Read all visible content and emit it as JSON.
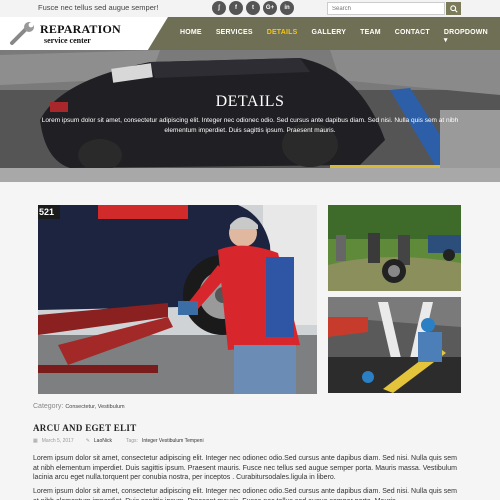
{
  "topbar": {
    "tagline": "Fusce nec tellus sed augue semper!",
    "socials": [
      {
        "icon": "rss-icon",
        "glyph": "ʃ"
      },
      {
        "icon": "facebook-icon",
        "glyph": "f"
      },
      {
        "icon": "twitter-icon",
        "glyph": "t"
      },
      {
        "icon": "google-plus-icon",
        "glyph": "G+"
      },
      {
        "icon": "linkedin-icon",
        "glyph": "in"
      }
    ],
    "search_placeholder": "Search"
  },
  "logo": {
    "title": "REPARATION",
    "subtitle": "service center"
  },
  "nav": {
    "items": [
      "HOME",
      "SERVICES",
      "DETAILS",
      "GALLERY",
      "TEAM",
      "CONTACT",
      "DROPDOWN ▾"
    ],
    "active_index": 2
  },
  "hero": {
    "title": "DETAILS",
    "text": "Lorem ipsum dolor sit amet, consectetur adipiscing elit. Integer nec odionec odio. Sed cursus ante dapibus diam. Sed nisi. Nulla quis sem at nibh elementum imperdiet. Duis sagittis ipsum. Praesent mauris."
  },
  "car_plate": "521",
  "article": {
    "category_label": "Category:",
    "category_values": "Consectetur, Vestibulum",
    "title": "ARCU AND EGET ELIT",
    "date": "March 5, 2017",
    "author": "LaoNick",
    "tags_label": "Tags:",
    "tags": "Integer Vestibulum Tempeni",
    "paragraphs": [
      "Lorem ipsum dolor sit amet, consectetur adipiscing elit. Integer nec odionec odio.Sed cursus ante dapibus diam. Sed nisi. Nulla quis sem at nibh elementum imperdiet. Duis sagittis ipsum. Praesent mauris. Fusce nec tellus sed augue semper porta. Mauris massa. Vestibulum lacinia arcu eget nulla.torquent per conubia nostra, per inceptos . Curabitursodales.ligula in libero.",
      "Lorem ipsum dolor sit amet, consectetur adipiscing elit. Integer nec odionec odio.Sed cursus ante dapibus diam. Sed nisi. Nulla quis sem at nibh elementum imperdiet. Duis sagittis ipsum. Praesent mauris. Fusce nec tellus sed augue semper porta. Mauris."
    ]
  },
  "colors": {
    "nav_bg": "#6f6f55",
    "active": "#f5c518",
    "search_btn": "#7b7b5a"
  }
}
